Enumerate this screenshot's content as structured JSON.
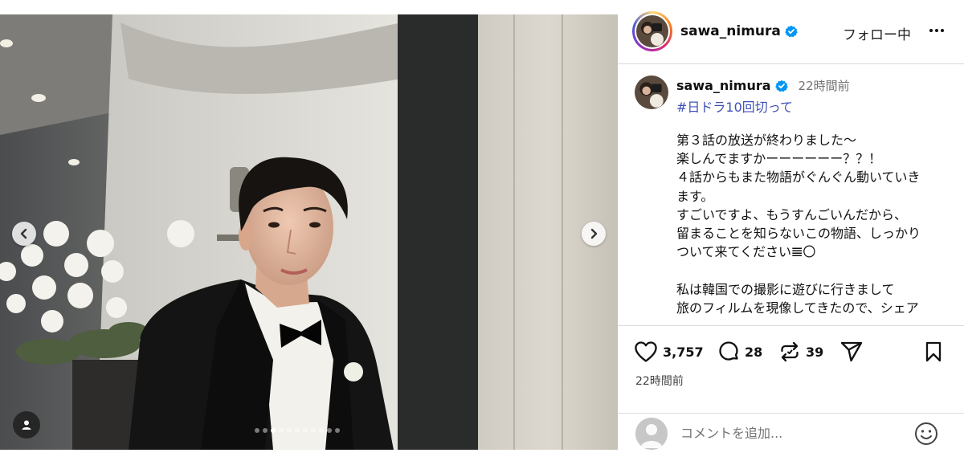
{
  "post": {
    "username": "sawa_nimura",
    "verified": true,
    "follow_label": "フォロー中",
    "more_icon": "more-horizontal-icon"
  },
  "caption": {
    "username": "sawa_nimura",
    "time": "22時間前",
    "hashtag": "#日ドラ10回切って",
    "lines": [
      "第３話の放送が終わりました〜",
      "楽しんでますかーーーーーー？？！",
      "４話からもまた物語がぐんぐん動いていき",
      "ます。",
      "すごいですよ、もうすんごいんだから、",
      "留まることを知らないこの物語、しっかり",
      "ついて来てください𝌆〇",
      "",
      "私は韓国での撮影に遊びに行きまして",
      "旅のフィルムを現像してきたので、シェア",
      "。"
    ]
  },
  "actions": {
    "likes": "3,757",
    "comments": "28",
    "reposts": "39",
    "timestamp": "22時間前"
  },
  "comment_box": {
    "placeholder": "コメントを追加..."
  },
  "carousel": {
    "slide_count": 11,
    "active_index": 2
  },
  "colors": {
    "verified_blue": "#0095f6",
    "hashtag_blue": "#3f51b5",
    "divider": "#dbdbdb",
    "muted_text": "#737373"
  }
}
